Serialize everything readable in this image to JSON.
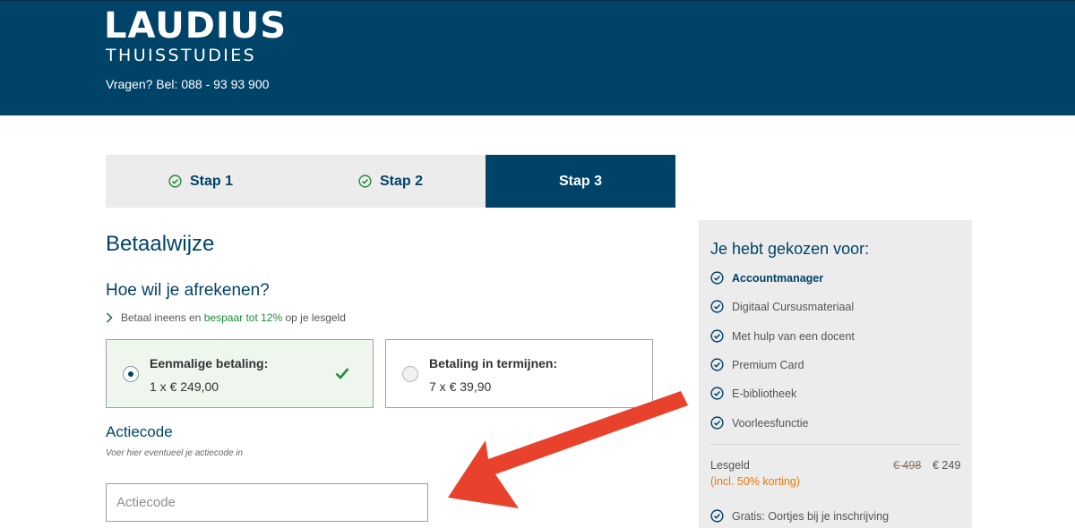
{
  "header": {
    "logo_main": "LAUDIUS",
    "logo_sub": "THUISSTUDIES",
    "phone": "Vragen? Bel: 088 - 93 93 900",
    "bg_color": "#004369"
  },
  "steps": [
    {
      "label": "Stap 1",
      "done": true
    },
    {
      "label": "Stap 2",
      "done": true
    },
    {
      "label": "Stap 3",
      "active": true
    }
  ],
  "payment": {
    "title": "Betaalwijze",
    "question": "Hoe wil je afrekenen?",
    "promo_pre": "Betaal ineens en",
    "promo_highlight": "bespaar tot 12%",
    "promo_post": "op je lesgeld",
    "options": [
      {
        "title": "Eenmalige betaling:",
        "price": "1 x € 249,00",
        "selected": true
      },
      {
        "title": "Betaling in termijnen:",
        "price": "7 x € 39,90",
        "selected": false
      }
    ]
  },
  "actiecode": {
    "title": "Actiecode",
    "hint": "Voer hier eventueel je actiecode in",
    "placeholder": "Actiecode",
    "value": ""
  },
  "summary": {
    "title": "Je hebt gekozen voor:",
    "items": [
      "Accountmanager",
      "Digitaal Cursusmateriaal",
      "Met hulp van een docent",
      "Premium Card",
      "E-bibliotheek",
      "Voorleesfunctie"
    ],
    "fee_label": "Lesgeld",
    "fee_note": "(incl. 50% korting)",
    "old_price": "€ 498",
    "new_price": "€ 249",
    "gift": "Gratis: Oortjes bij je inschrijving"
  },
  "colors": {
    "brand": "#004369",
    "success": "#1e8c3a",
    "discount": "#e8780f",
    "annotation_arrow": "#e8412c"
  },
  "icons": {
    "step_done": "check-circle-icon",
    "promo": "chevron-right-icon",
    "selected": "checkmark-icon",
    "summary_item": "check-circle-icon"
  }
}
